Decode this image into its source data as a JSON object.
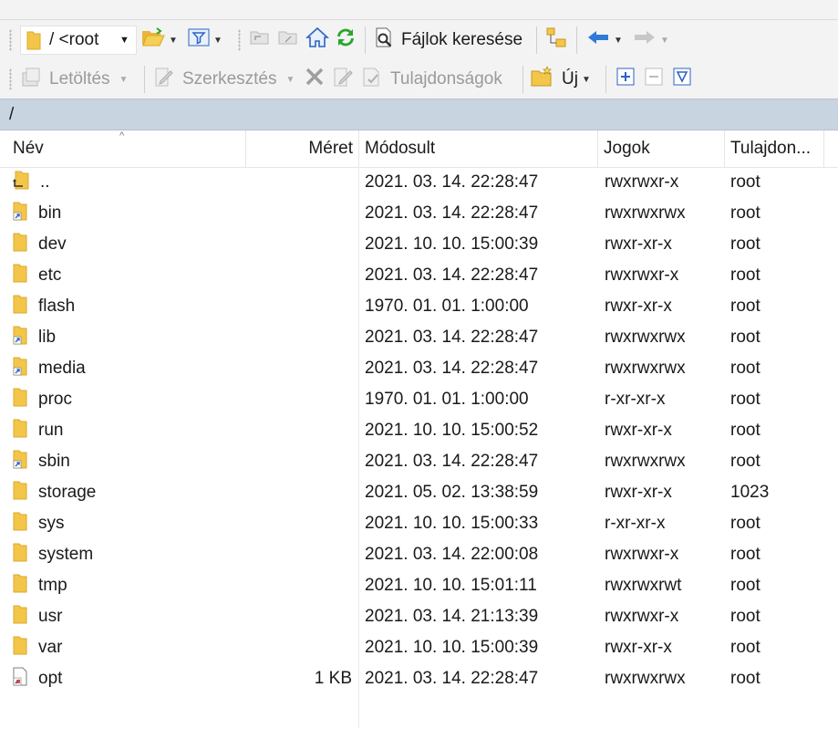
{
  "toolbar": {
    "path_combo_value": "/ <root",
    "find_files_label": "Fájlok keresése"
  },
  "toolbar2": {
    "download_label": "Letöltés",
    "edit_label": "Szerkesztés",
    "properties_label": "Tulajdonságok",
    "new_label": "Új"
  },
  "pathbar": {
    "path": "/"
  },
  "columns": {
    "name": "Név",
    "size": "Méret",
    "modified": "Módosult",
    "permissions": "Jogok",
    "owner": "Tulajdon..."
  },
  "files": [
    {
      "name": "..",
      "size": "",
      "modified": "2021. 03. 14. 22:28:47",
      "permissions": "rwxrwxr-x",
      "owner": "root",
      "icon": "parent-folder-icon"
    },
    {
      "name": "bin",
      "size": "",
      "modified": "2021. 03. 14. 22:28:47",
      "permissions": "rwxrwxrwx",
      "owner": "root",
      "icon": "folder-link-icon"
    },
    {
      "name": "dev",
      "size": "",
      "modified": "2021. 10. 10. 15:00:39",
      "permissions": "rwxr-xr-x",
      "owner": "root",
      "icon": "folder-icon"
    },
    {
      "name": "etc",
      "size": "",
      "modified": "2021. 03. 14. 22:28:47",
      "permissions": "rwxrwxr-x",
      "owner": "root",
      "icon": "folder-icon"
    },
    {
      "name": "flash",
      "size": "",
      "modified": "1970. 01. 01. 1:00:00",
      "permissions": "rwxr-xr-x",
      "owner": "root",
      "icon": "folder-icon"
    },
    {
      "name": "lib",
      "size": "",
      "modified": "2021. 03. 14. 22:28:47",
      "permissions": "rwxrwxrwx",
      "owner": "root",
      "icon": "folder-link-icon"
    },
    {
      "name": "media",
      "size": "",
      "modified": "2021. 03. 14. 22:28:47",
      "permissions": "rwxrwxrwx",
      "owner": "root",
      "icon": "folder-link-icon"
    },
    {
      "name": "proc",
      "size": "",
      "modified": "1970. 01. 01. 1:00:00",
      "permissions": "r-xr-xr-x",
      "owner": "root",
      "icon": "folder-icon"
    },
    {
      "name": "run",
      "size": "",
      "modified": "2021. 10. 10. 15:00:52",
      "permissions": "rwxr-xr-x",
      "owner": "root",
      "icon": "folder-icon"
    },
    {
      "name": "sbin",
      "size": "",
      "modified": "2021. 03. 14. 22:28:47",
      "permissions": "rwxrwxrwx",
      "owner": "root",
      "icon": "folder-link-icon"
    },
    {
      "name": "storage",
      "size": "",
      "modified": "2021. 05. 02. 13:38:59",
      "permissions": "rwxr-xr-x",
      "owner": "1023",
      "icon": "folder-icon"
    },
    {
      "name": "sys",
      "size": "",
      "modified": "2021. 10. 10. 15:00:33",
      "permissions": "r-xr-xr-x",
      "owner": "root",
      "icon": "folder-icon"
    },
    {
      "name": "system",
      "size": "",
      "modified": "2021. 03. 14. 22:00:08",
      "permissions": "rwxrwxr-x",
      "owner": "root",
      "icon": "folder-icon"
    },
    {
      "name": "tmp",
      "size": "",
      "modified": "2021. 10. 10. 15:01:11",
      "permissions": "rwxrwxrwt",
      "owner": "root",
      "icon": "folder-icon"
    },
    {
      "name": "usr",
      "size": "",
      "modified": "2021. 03. 14. 21:13:39",
      "permissions": "rwxrwxr-x",
      "owner": "root",
      "icon": "folder-icon"
    },
    {
      "name": "var",
      "size": "",
      "modified": "2021. 10. 10. 15:00:39",
      "permissions": "rwxr-xr-x",
      "owner": "root",
      "icon": "folder-icon"
    },
    {
      "name": "opt",
      "size": "1 KB",
      "modified": "2021. 03. 14. 22:28:47",
      "permissions": "rwxrwxrwx",
      "owner": "root",
      "icon": "file-link-icon"
    }
  ],
  "colors": {
    "folder": "#f3c64a",
    "link_arrow": "#2b63c4",
    "pathbar_bg": "#c9d4e1",
    "refresh_green": "#2aa52a"
  }
}
